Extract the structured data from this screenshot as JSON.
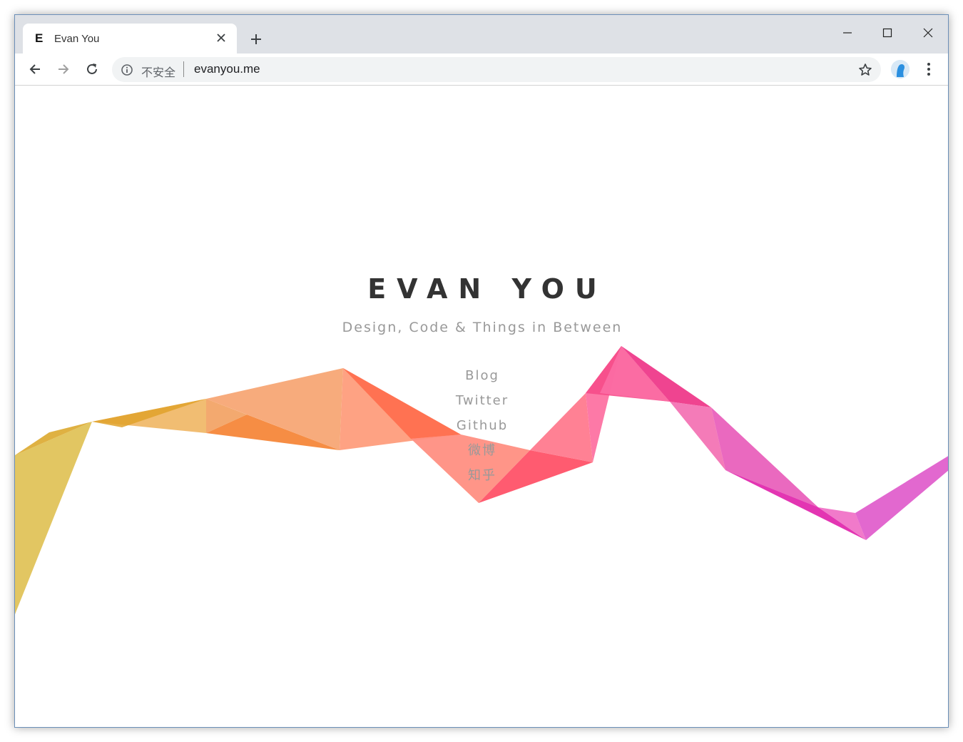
{
  "browser": {
    "tab": {
      "favicon": "E",
      "title": "Evan You",
      "close_icon": "close-icon"
    },
    "new_tab_icon": "plus-icon",
    "window_controls": [
      "minimize-icon",
      "maximize-icon",
      "close-icon"
    ],
    "toolbar": {
      "back_icon": "arrow-left-icon",
      "forward_icon": "arrow-right-icon",
      "reload_icon": "reload-icon",
      "security_label": "不安全",
      "url": "evanyou.me",
      "bookmark_icon": "star-icon",
      "menu_icon": "more-vert-icon"
    }
  },
  "page": {
    "title": "EVAN YOU",
    "tagline": "Design, Code & Things in Between",
    "links": [
      "Blog",
      "Twitter",
      "Github",
      "微博",
      "知乎"
    ]
  },
  "colors": {
    "title": "#333333",
    "text_muted": "#999999",
    "ribbon": [
      "#e0c35a",
      "#e8a838",
      "#f5a06a",
      "#ff7a52",
      "#ff5470",
      "#f0508a",
      "#e84fb0",
      "#e060cc"
    ]
  }
}
